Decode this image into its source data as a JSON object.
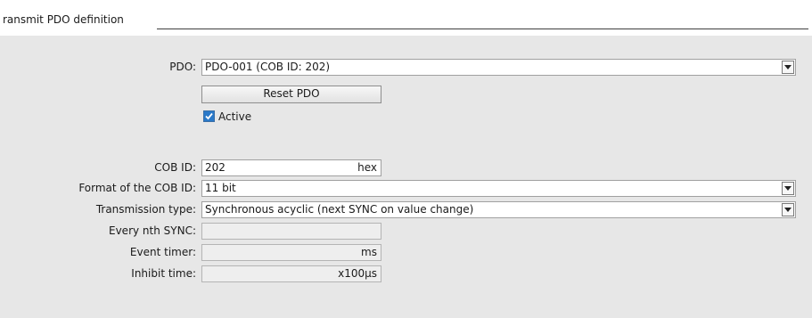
{
  "section": {
    "title": "ransmit PDO definition"
  },
  "pdo": {
    "label": "PDO:",
    "value": "PDO-001 (COB ID: 202)",
    "reset_label": "Reset PDO",
    "active_label": "Active",
    "active_checked": true
  },
  "cob_id": {
    "label": "COB ID:",
    "value": "202",
    "unit": "hex"
  },
  "cob_format": {
    "label": "Format of the COB ID:",
    "value": "11 bit"
  },
  "transmission": {
    "label": "Transmission type:",
    "value": "Synchronous acyclic (next SYNC on value change)"
  },
  "nth_sync": {
    "label": "Every nth SYNC:",
    "value": ""
  },
  "event_timer": {
    "label": "Event timer:",
    "value": "",
    "unit": "ms"
  },
  "inhibit_time": {
    "label": "Inhibit time:",
    "value": "",
    "unit": "x100µs"
  },
  "icons": {
    "dropdown": "chevron-down-icon",
    "checkbox": "check-icon"
  },
  "colors": {
    "checkbox_blue": "#2a79c9",
    "panel_bg": "#e7e7e7"
  }
}
